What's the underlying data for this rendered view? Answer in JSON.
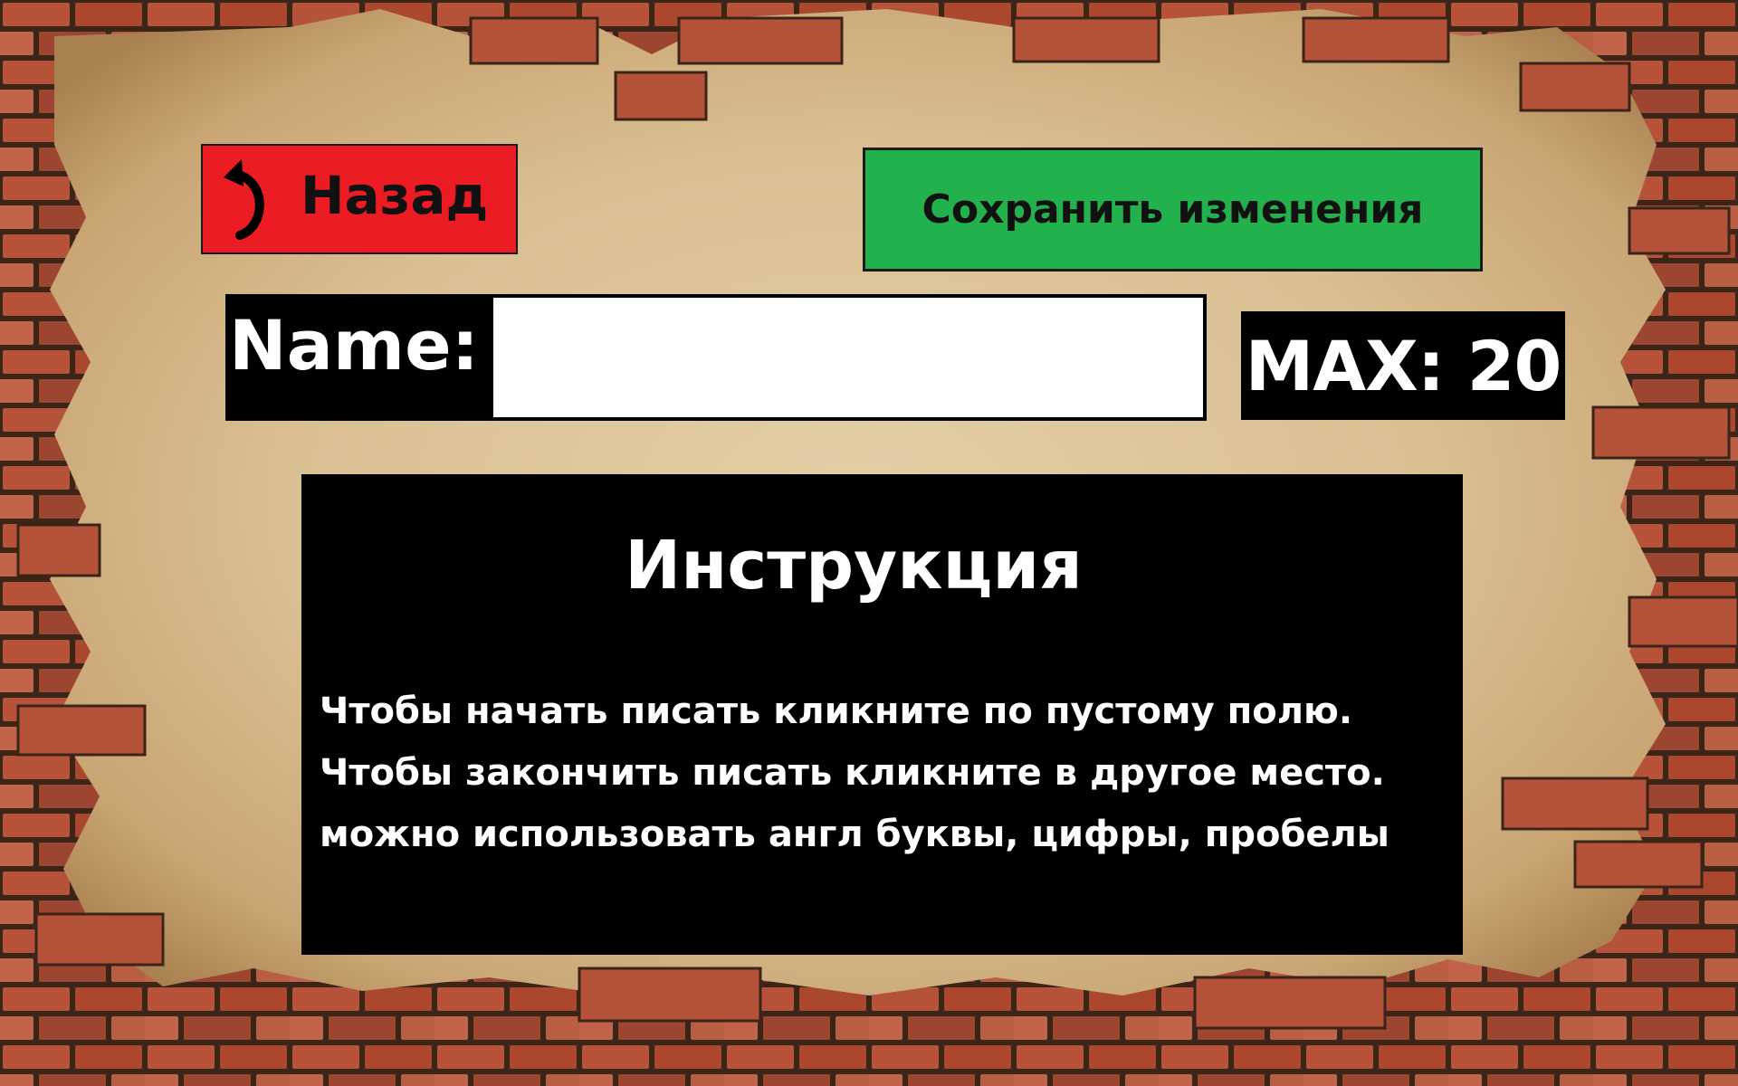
{
  "header": {
    "back_label": "Назад",
    "save_label": "Сохранить изменения"
  },
  "name_row": {
    "label": "Name:",
    "input_value": "",
    "max_label": "MAX: 20"
  },
  "instructions": {
    "title": "Инструкция",
    "lines": [
      "Чтобы начать писать кликните по пустому полю.",
      "Чтобы закончить писать кликните в другое место.",
      "можно использовать англ буквы, цифры, пробелы"
    ]
  },
  "colors": {
    "back_button": "#ec1c24",
    "save_button": "#22b14c",
    "panel": "#000000",
    "text_light": "#ffffff",
    "parchment": "#dcc49a",
    "brick": "#b4553a"
  },
  "icons": {
    "back": "curved-back-arrow-icon"
  }
}
